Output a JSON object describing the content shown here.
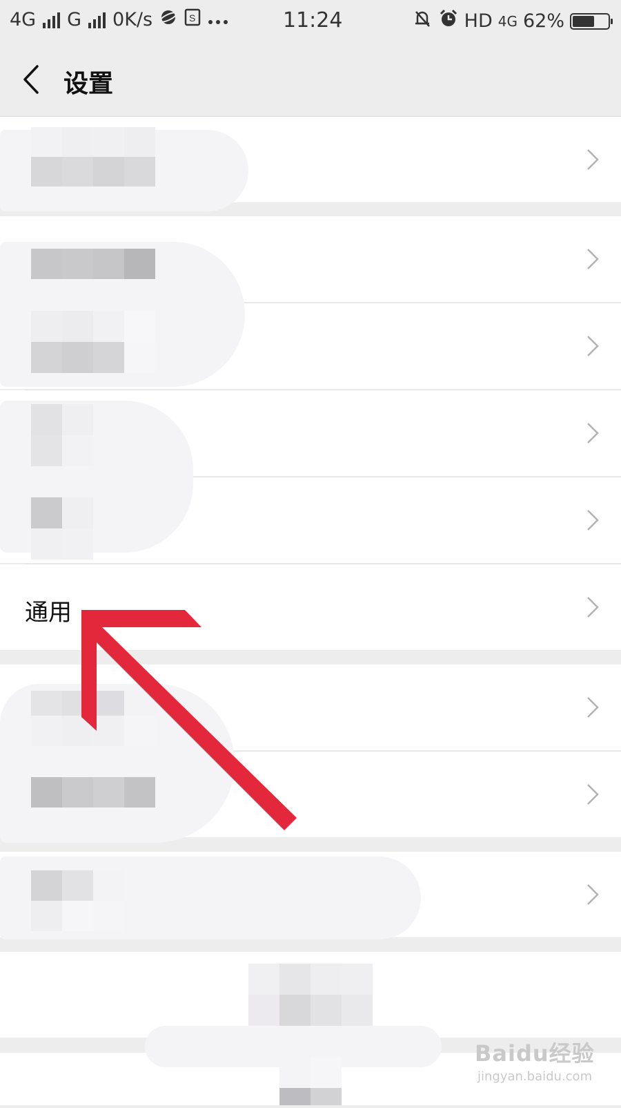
{
  "status_bar": {
    "network_1": "4G",
    "network_2": "G",
    "speed": "0K/s",
    "time": "11:24",
    "hd": "HD",
    "network_3": "4G",
    "battery": "62%",
    "battery_level": 0.62
  },
  "nav": {
    "title": "设置"
  },
  "rows": {
    "general_label": "通用"
  },
  "watermark": {
    "logo": "Baidu经验",
    "url": "jingyan.baidu.com"
  },
  "colors": {
    "accent_arrow": "#e4283c",
    "background": "#ededed",
    "row": "#ffffff",
    "chevron": "#b2b2b2"
  }
}
